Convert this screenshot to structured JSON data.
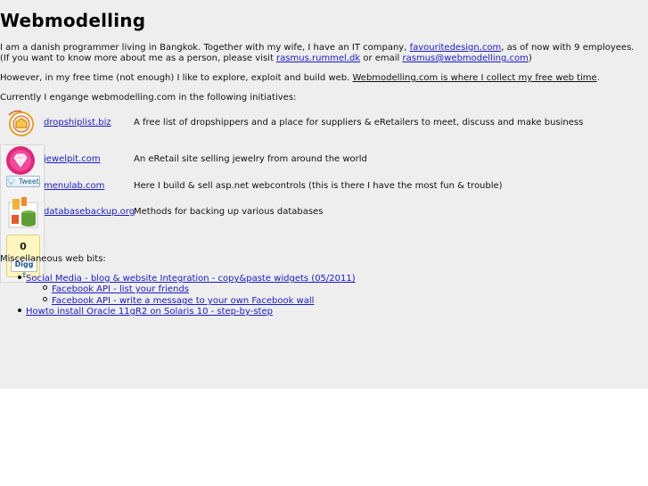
{
  "header": {
    "title": "Webmodelling"
  },
  "intro": {
    "line1_prefix": "I am a danish programmer living in Bangkok. Together with my wife, I have an IT company, ",
    "line1_link": "favouritedesign.com",
    "line1_suffix": ", as of now with 9 employees.",
    "line2_prefix": "(If you want to know more about me as a person, please visit ",
    "line2_link1": "rasmus.rummel.dk",
    "line2_mid": " or email ",
    "line2_link2": "rasmus@webmodelling.com",
    "line2_suffix": ")",
    "line3_prefix": "However, in my free time (not enough) I like to explore, exploit and build web. ",
    "line3_link": "Webmodelling.com is where I collect my free web time",
    "line3_suffix": ".",
    "line4": "Currently I engange webmodelling.com in the following initiatives:"
  },
  "initiatives": [
    {
      "link": "dropshiplist.biz",
      "desc": "A free list of dropshippers and a place for suppliers & eRetailers to meet, discuss and make business",
      "icon": "dropship-logo-icon"
    },
    {
      "link": "jewelpit.com",
      "desc": "An eRetail site selling jewelry from around the world",
      "icon": "diamond-icon"
    },
    {
      "link": "menulab.com",
      "desc": "Here I build & sell asp.net webcontrols (this is there I have the most fun & trouble)",
      "icon": ""
    },
    {
      "link": "databasebackup.org",
      "desc": "Methods for backing up various databases",
      "icon": "database-icon"
    }
  ],
  "social": {
    "tweet_label": "Tweet",
    "digg_count": "0",
    "digg_label": "Digg"
  },
  "misc": {
    "heading": "Miscellaneous web bits:",
    "items": [
      {
        "label": "Social Media - blog & website Integration - copy&paste widgets (05/2011)"
      },
      {
        "label": "Facebook API - list your friends"
      },
      {
        "label": "Facebook API - write a message to your own Facebook wall"
      },
      {
        "label": "Howto install Oracle 11gR2 on Solaris 10 - step-by-step"
      }
    ]
  }
}
